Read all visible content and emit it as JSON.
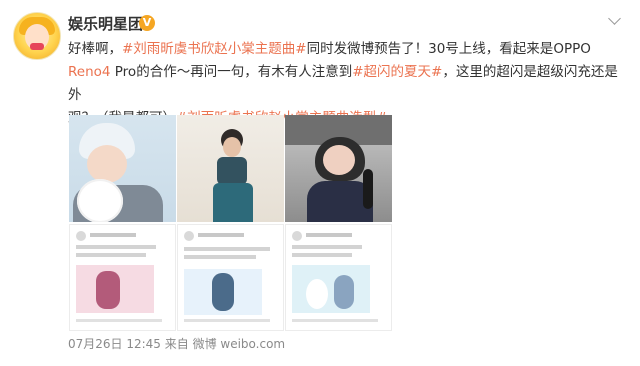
{
  "account": {
    "name": "娱乐明星团",
    "verified_badge": "V",
    "avatar_text": "娱乐明星团"
  },
  "post": {
    "line1_pre": "好棒啊，",
    "tag1": "#刘雨昕虞书欣赵小棠主题曲#",
    "line1_post": "同时发微博预告了！30号上线，看起来是",
    "oppo": "OPPO",
    "reno": "Reno4",
    "line2_mid": " Pro的合作～再问一句，有木有人注意到",
    "tag2": "#超闪的夏天#",
    "line2_post": "，这里的超闪是超级闪充还是外",
    "line3_pre": "观？（我是都可）",
    "tag3": "#刘雨昕虞书欣赵小棠主题曲造型#"
  },
  "images": [
    {
      "name": "photo-1"
    },
    {
      "name": "photo-2"
    },
    {
      "name": "photo-3"
    },
    {
      "name": "screenshot-1"
    },
    {
      "name": "screenshot-2"
    },
    {
      "name": "screenshot-3"
    }
  ],
  "meta": {
    "timestamp": "07月26日 12:45",
    "source": "来自 微博 weibo.com"
  },
  "colors": {
    "tag": "#eb7350",
    "badge": "#f5a623",
    "text": "#333333",
    "meta": "#8a8a8a"
  }
}
